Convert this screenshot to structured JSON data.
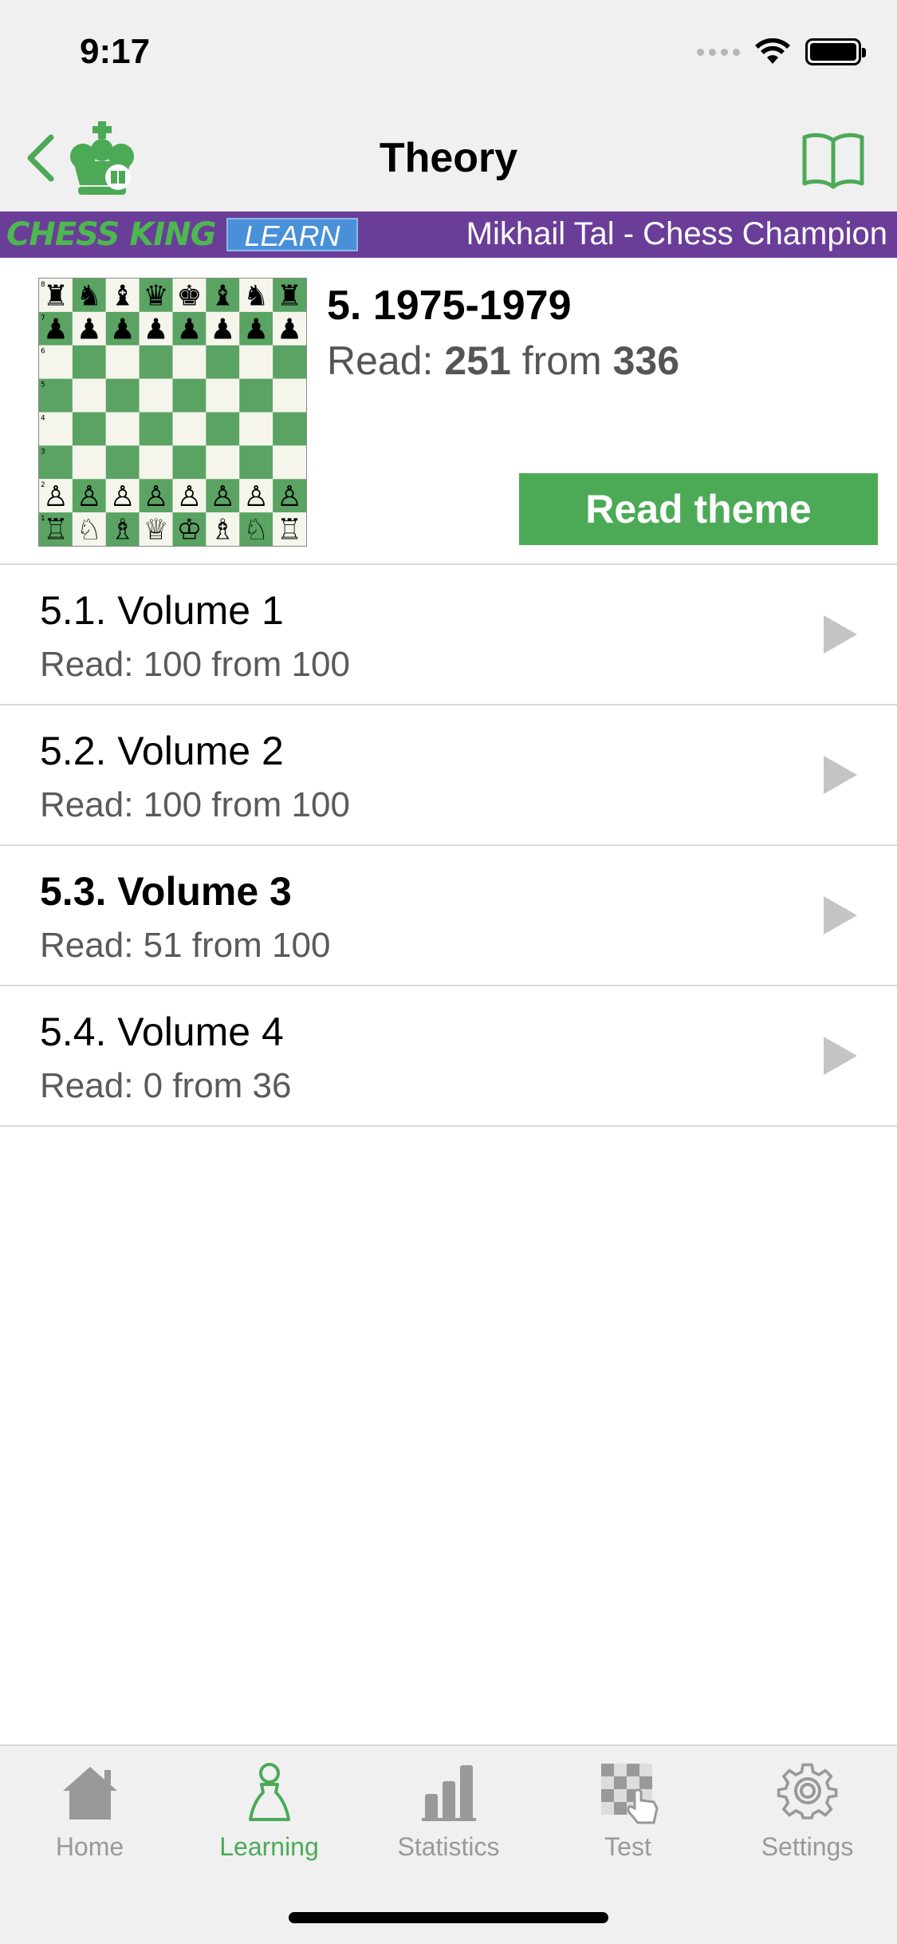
{
  "status": {
    "time": "9:17"
  },
  "nav": {
    "title": "Theory",
    "back_icon": "chevron-left-icon",
    "logo_icon": "king-logo-icon",
    "book_icon": "book-icon"
  },
  "banner": {
    "brand": "CHESS KING",
    "badge": "LEARN",
    "subtitle": "Mikhail Tal - Chess Champion",
    "bg_color": "#6a3e98"
  },
  "theme": {
    "title": "5. 1975-1979",
    "read_label": "Read:",
    "read_count": "251",
    "from_label": "from",
    "total": "336",
    "button_label": "Read theme",
    "accent_color": "#4caa57"
  },
  "volumes": [
    {
      "title": "5.1. Volume 1",
      "subtitle": "Read: 100 from 100",
      "current": false
    },
    {
      "title": "5.2. Volume 2",
      "subtitle": "Read: 100 from 100",
      "current": false
    },
    {
      "title": "5.3. Volume 3",
      "subtitle": "Read: 51 from 100",
      "current": true
    },
    {
      "title": "5.4. Volume 4",
      "subtitle": "Read: 0 from 36",
      "current": false
    }
  ],
  "tabs": [
    {
      "label": "Home",
      "icon": "home-icon",
      "active": false
    },
    {
      "label": "Learning",
      "icon": "pawn-icon",
      "active": true
    },
    {
      "label": "Statistics",
      "icon": "bar-chart-icon",
      "active": false
    },
    {
      "label": "Test",
      "icon": "checkerboard-hand-icon",
      "active": false
    },
    {
      "label": "Settings",
      "icon": "gear-icon",
      "active": false
    }
  ]
}
